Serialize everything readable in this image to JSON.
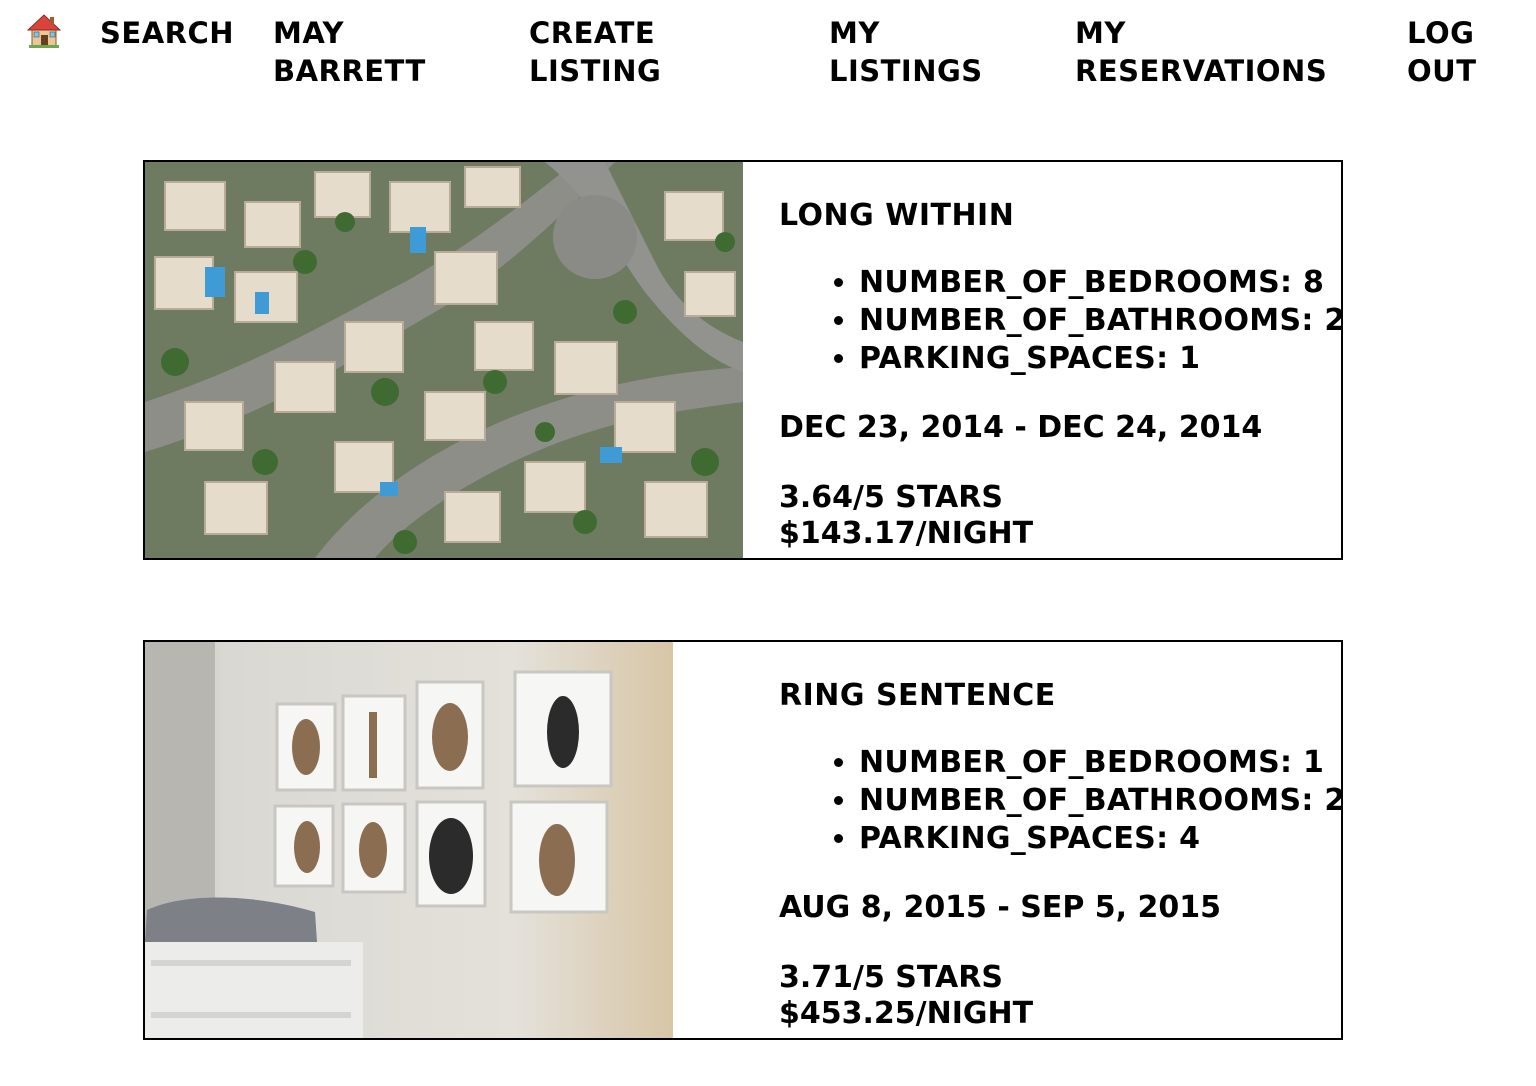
{
  "nav": {
    "home_icon": "house-icon",
    "search": "Search",
    "user": "May\nBarrett",
    "create_listing": "Create\nListing",
    "my_listings": "My\nListings",
    "my_reservations": "My\nReservations",
    "log_out": "Log\nOut"
  },
  "reservations": [
    {
      "title": "Long within",
      "specs": [
        "number_of_bedrooms: 8",
        "number_of_bathrooms: 2",
        "parking_spaces: 1"
      ],
      "dates": "Dec 23, 2014 - Dec 24, 2014",
      "rating": "3.64/5 stars",
      "price": "$143.17/night",
      "image": "aerial-neighborhood-photo"
    },
    {
      "title": "Ring sentence",
      "specs": [
        "number_of_bedrooms: 1",
        "number_of_bathrooms: 2",
        "parking_spaces: 4"
      ],
      "dates": "Aug 8, 2015 - Sep 5, 2015",
      "rating": "3.71/5 stars",
      "price": "$453.25/night",
      "image": "nursery-animal-prints-photo"
    }
  ]
}
